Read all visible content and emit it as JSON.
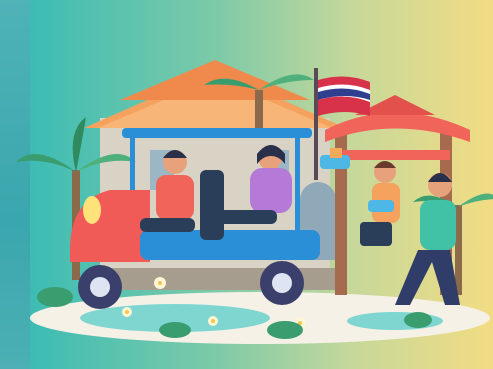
{
  "scene": {
    "description_label": "",
    "flag_colors": [
      "#d8324a",
      "#ffffff",
      "#2f3f8f"
    ],
    "palette": {
      "sky_left": "#3dbcb4",
      "sky_right": "#f2dc83",
      "tuktuk_body": "#2a8fd6",
      "tuktuk_red": "#f05a57",
      "roof_orange": "#f5a25e",
      "gate_red": "#f0645a",
      "water": "#7fd6d1"
    }
  }
}
